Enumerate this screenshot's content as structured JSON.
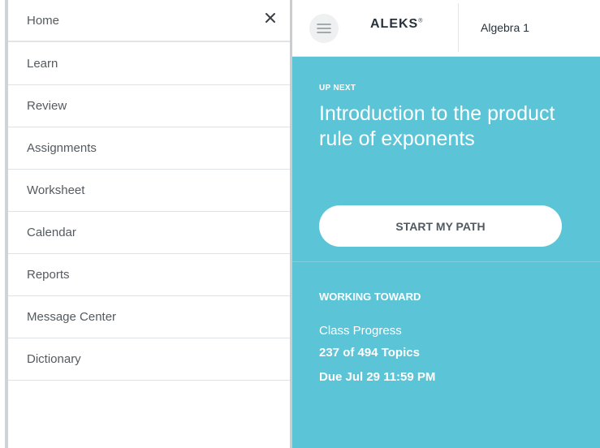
{
  "sidebar": {
    "items": [
      {
        "label": "Home"
      },
      {
        "label": "Learn"
      },
      {
        "label": "Review"
      },
      {
        "label": "Assignments"
      },
      {
        "label": "Worksheet"
      },
      {
        "label": "Calendar"
      },
      {
        "label": "Reports"
      },
      {
        "label": "Message Center"
      },
      {
        "label": "Dictionary"
      }
    ],
    "close_icon": "close-icon"
  },
  "header": {
    "menu_icon": "hamburger-icon",
    "logo": "ALEKS",
    "logo_mark": "®",
    "course": "Algebra 1"
  },
  "up_next": {
    "label": "UP NEXT",
    "topic": "Introduction to the product rule of exponents",
    "button_label": "START MY PATH"
  },
  "working_toward": {
    "label": "WORKING TOWARD",
    "progress_label": "Class Progress",
    "topics": "237 of 494 Topics",
    "due": "Due Jul 29 11:59 PM"
  },
  "colors": {
    "panel": "#5bc4d6",
    "menu_text": "#555a5e",
    "divider": "#c9cdd0"
  }
}
